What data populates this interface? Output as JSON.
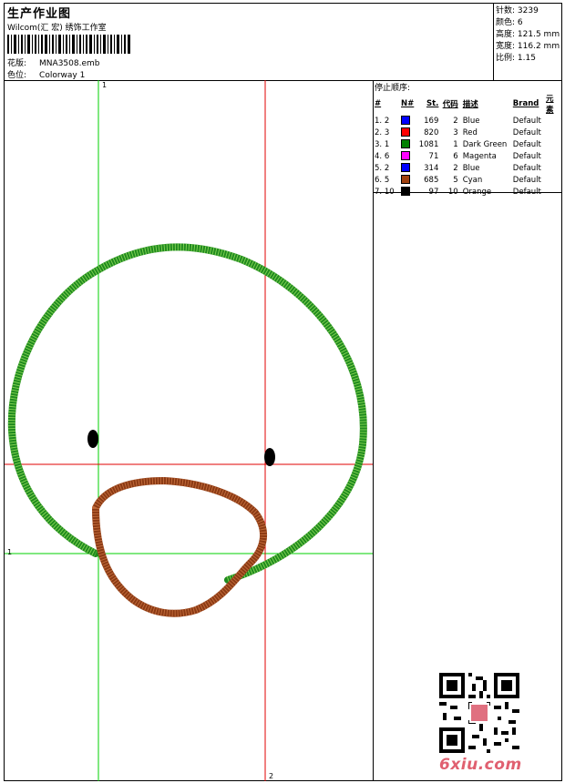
{
  "header": {
    "title": "生产作业图",
    "subtitle": "Wilcom(汇 宏) 绣饰工作室",
    "design_label": "花版:",
    "design_value": "MNA3508.emb",
    "colorway_label": "色位:",
    "colorway_value": "Colorway 1"
  },
  "stats": [
    {
      "label": "针数:",
      "value": "3239"
    },
    {
      "label": "颜色:",
      "value": "6"
    },
    {
      "label": "高度:",
      "value": "121.5 mm"
    },
    {
      "label": "宽度:",
      "value": "116.2 mm"
    },
    {
      "label": "比例:",
      "value": "1.15"
    }
  ],
  "stop_sequence": {
    "title": "停止顺序:",
    "columns": [
      "#",
      "N#",
      "St.",
      "代码",
      "描述",
      "Brand",
      "元素"
    ],
    "rows": [
      {
        "seq": "1.",
        "n": "2",
        "color": "#0000ff",
        "stitches": "169",
        "code": "2",
        "desc": "Blue",
        "brand": "Default"
      },
      {
        "seq": "2.",
        "n": "3",
        "color": "#ff0000",
        "stitches": "820",
        "code": "3",
        "desc": "Red",
        "brand": "Default"
      },
      {
        "seq": "3.",
        "n": "1",
        "color": "#008000",
        "stitches": "1081",
        "code": "1",
        "desc": "Dark Green",
        "brand": "Default"
      },
      {
        "seq": "4.",
        "n": "6",
        "color": "#ff00ff",
        "stitches": "71",
        "code": "6",
        "desc": "Magenta",
        "brand": "Default"
      },
      {
        "seq": "5.",
        "n": "2",
        "color": "#0000ff",
        "stitches": "314",
        "code": "2",
        "desc": "Blue",
        "brand": "Default"
      },
      {
        "seq": "6.",
        "n": "5",
        "color": "#a0410f",
        "stitches": "685",
        "code": "5",
        "desc": "Cyan",
        "brand": "Default"
      },
      {
        "seq": "7.",
        "n": "10",
        "color": "#000000",
        "stitches": "97",
        "code": "10",
        "desc": "Orange",
        "brand": "Default"
      }
    ]
  },
  "guides": {
    "green_label_top": "1",
    "green_label_left": "1",
    "red_label_bottom": "2",
    "green_color": "#00d000",
    "red_color": "#e00000"
  },
  "design_colors": {
    "outline": "#1f8a1f",
    "loop": "#8b3a14",
    "eyes": "#000000"
  },
  "watermark": {
    "text": "6xiu.com"
  }
}
